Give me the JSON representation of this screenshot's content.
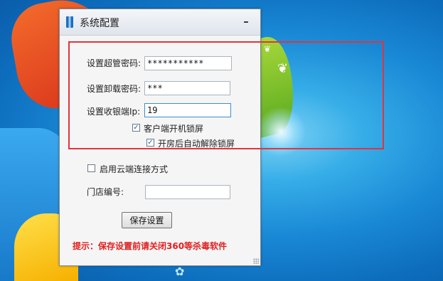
{
  "window": {
    "title": "系统配置",
    "minimize_glyph": "–",
    "icon": "app-icon"
  },
  "form": {
    "admin_password": {
      "label": "设置超管密码:",
      "value": "***********"
    },
    "uninstall_password": {
      "label": "设置卸载密码:",
      "value": "***"
    },
    "cashier_ip": {
      "label": "设置收银端Ip:",
      "value": "19"
    },
    "autostart_lock": {
      "label": "客户端开机锁屏",
      "checked": true
    },
    "unlock_after_open": {
      "label": "开房后自动解除锁屏",
      "checked": true
    },
    "cloud_connection": {
      "label": "启用云端连接方式",
      "checked": false
    },
    "store_number": {
      "label": "门店编号:",
      "value": ""
    }
  },
  "buttons": {
    "save_label": "保存设置"
  },
  "hint": "提示：保存设置前请关闭360等杀毒软件",
  "check_glyph": "✓",
  "colors": {
    "hint_red": "#e02020",
    "annotation_red": "#e2333f",
    "checkbox_tick": "#1f5fa8"
  }
}
